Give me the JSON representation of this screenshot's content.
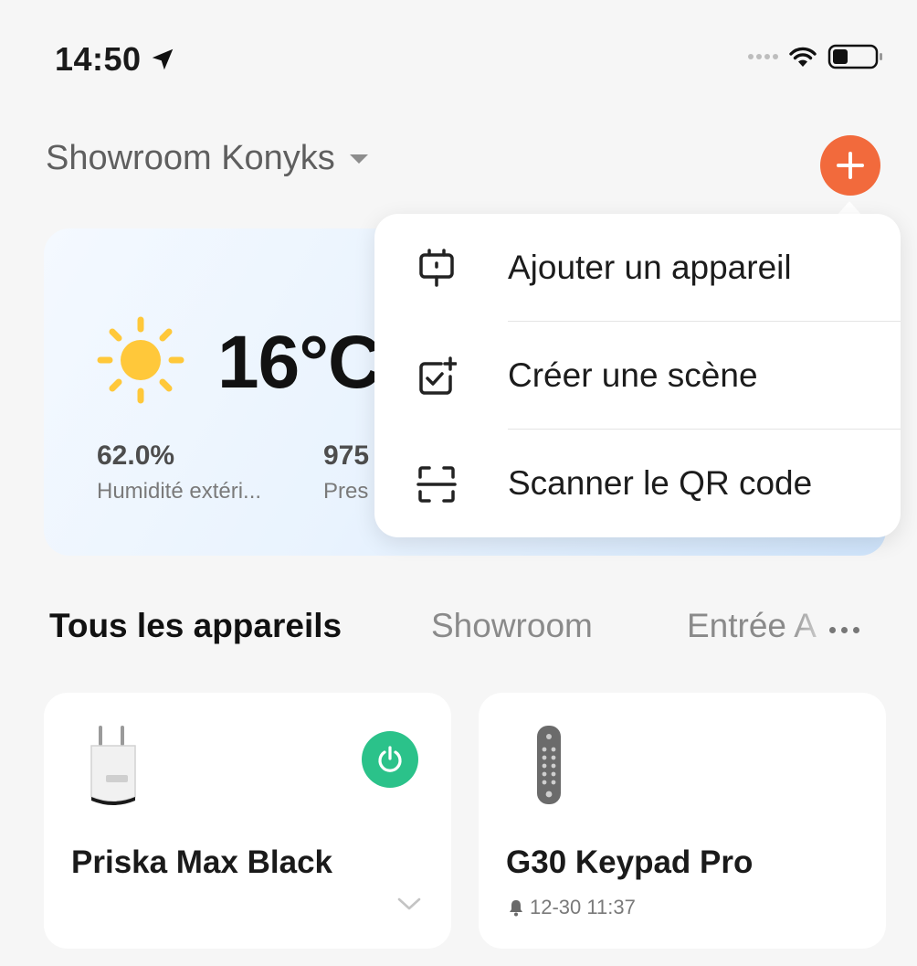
{
  "status_bar": {
    "time": "14:50"
  },
  "header": {
    "home_name": "Showroom Konyks"
  },
  "weather": {
    "temperature": "16°C",
    "stats": [
      {
        "value": "62.0%",
        "label": "Humidité extéri..."
      },
      {
        "value": "975",
        "label": "Pres"
      }
    ]
  },
  "menu": {
    "items": [
      {
        "label": "Ajouter un appareil",
        "icon": "add-device-icon"
      },
      {
        "label": "Créer une scène",
        "icon": "create-scene-icon"
      },
      {
        "label": "Scanner le QR code",
        "icon": "qr-scan-icon"
      }
    ]
  },
  "tabs": {
    "active": "Tous les appareils",
    "items": [
      "Showroom",
      "Entrée A"
    ]
  },
  "devices": [
    {
      "name": "Priska Max Black",
      "icon": "smart-plug-icon"
    },
    {
      "name": "G30 Keypad Pro",
      "time": "12-30 11:37",
      "icon": "keypad-icon"
    }
  ],
  "colors": {
    "accent": "#f26a3c",
    "power_on": "#2bc28a",
    "background": "#f6f6f6"
  }
}
